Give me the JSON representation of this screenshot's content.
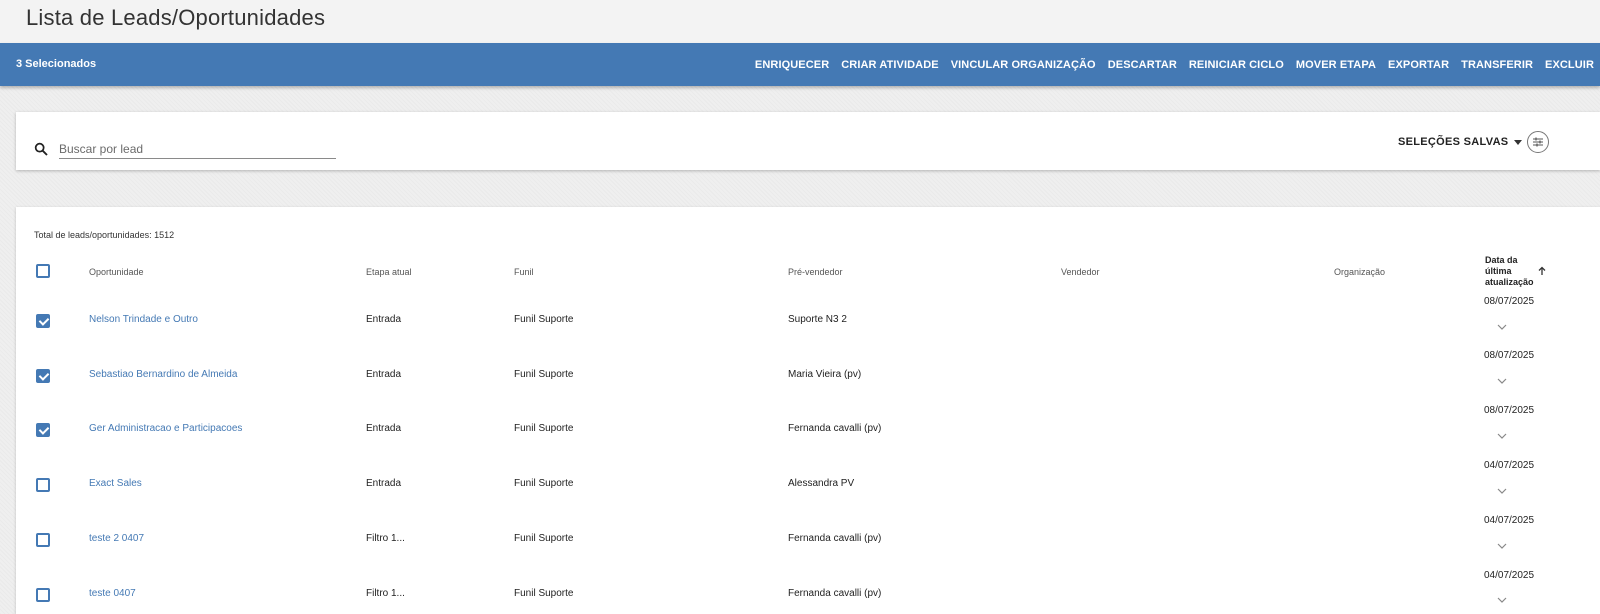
{
  "page": {
    "title": "Lista de Leads/Oportunidades"
  },
  "action_bar": {
    "selected": "3 Selecionados",
    "actions": [
      "ENRIQUECER",
      "CRIAR ATIVIDADE",
      "VINCULAR ORGANIZAÇÃO",
      "DESCARTAR",
      "REINICIAR CICLO",
      "MOVER ETAPA",
      "EXPORTAR",
      "TRANSFERIR",
      "EXCLUIR"
    ]
  },
  "search": {
    "placeholder": "Buscar por lead",
    "value": "",
    "saved_label": "SELEÇÕES SALVAS"
  },
  "table": {
    "total": "Total de leads/oportunidades: 1512",
    "columns": {
      "opportunity": "Oportunidade",
      "stage": "Etapa atual",
      "funnel": "Funil",
      "presales": "Pré-vendedor",
      "seller": "Vendedor",
      "organization": "Organização",
      "date_1": "Data da",
      "date_2": "última",
      "date_3": "atualização"
    },
    "rows": [
      {
        "checked": true,
        "opportunity": "Nelson Trindade e Outro",
        "stage": "Entrada",
        "funnel": "Funil Suporte",
        "presales": "Suporte N3 2",
        "seller": "",
        "organization": "",
        "date": "08/07/2025"
      },
      {
        "checked": true,
        "opportunity": "Sebastiao Bernardino de Almeida",
        "stage": "Entrada",
        "funnel": "Funil Suporte",
        "presales": "Maria Vieira (pv)",
        "seller": "",
        "organization": "",
        "date": "08/07/2025"
      },
      {
        "checked": true,
        "opportunity": "Ger Administracao e Participacoes",
        "stage": "Entrada",
        "funnel": "Funil Suporte",
        "presales": "Fernanda cavalli (pv)",
        "seller": "",
        "organization": "",
        "date": "08/07/2025"
      },
      {
        "checked": false,
        "opportunity": "Exact Sales",
        "stage": "Entrada",
        "funnel": "Funil Suporte",
        "presales": "Alessandra PV",
        "seller": "",
        "organization": "",
        "date": "04/07/2025"
      },
      {
        "checked": false,
        "opportunity": "teste 2 0407",
        "stage": "Filtro 1...",
        "funnel": "Funil Suporte",
        "presales": "Fernanda cavalli (pv)",
        "seller": "",
        "organization": "",
        "date": "04/07/2025"
      },
      {
        "checked": false,
        "opportunity": "teste 0407",
        "stage": "Filtro 1...",
        "funnel": "Funil Suporte",
        "presales": "Fernanda cavalli (pv)",
        "seller": "",
        "organization": "",
        "date": "04/07/2025"
      }
    ]
  },
  "colors": {
    "primary": "#4479b4"
  }
}
